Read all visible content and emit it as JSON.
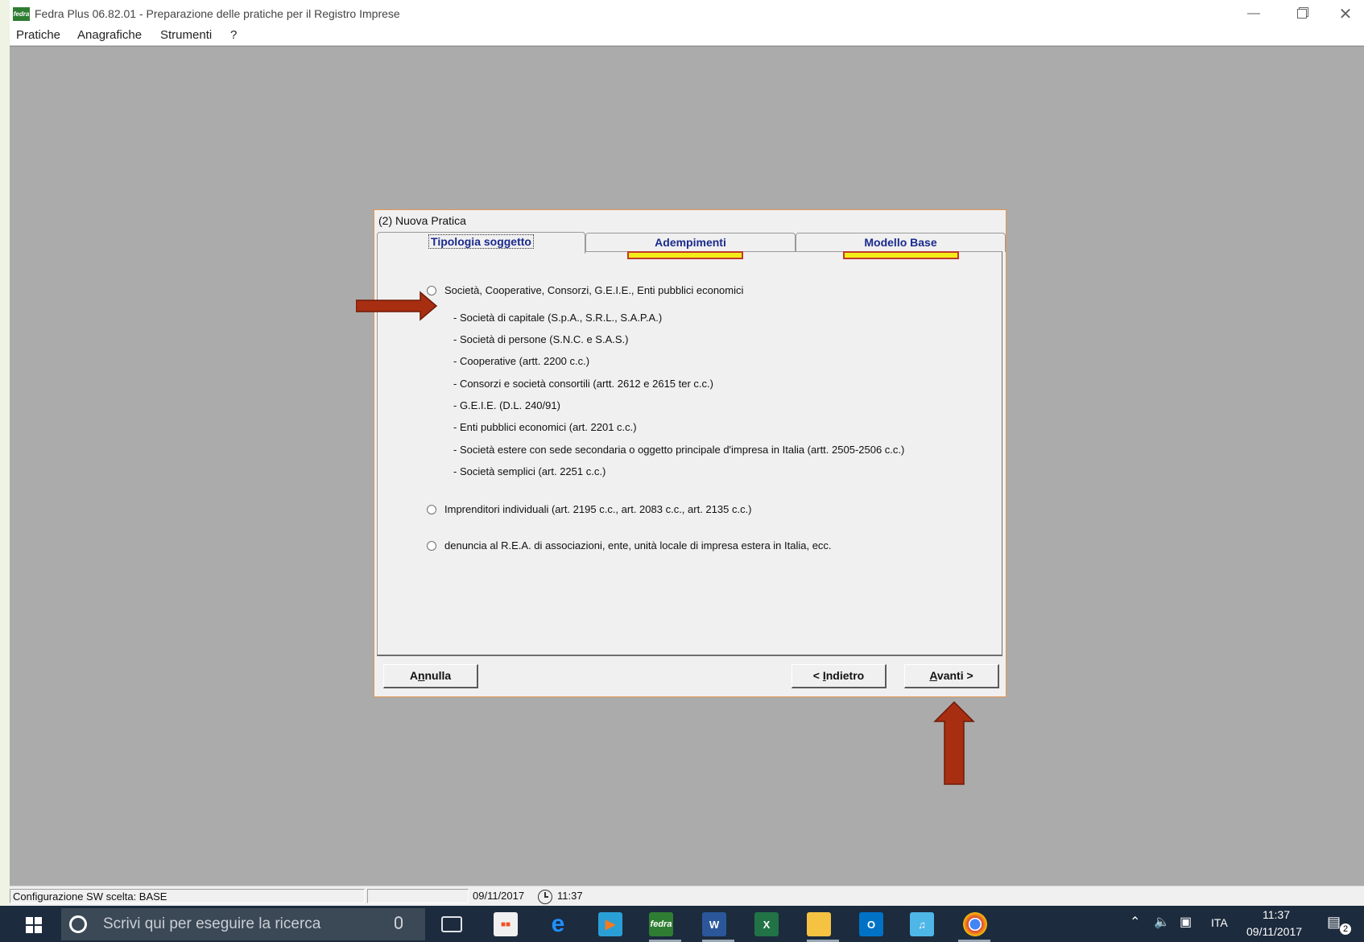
{
  "window": {
    "title": "Fedra Plus 06.82.01 - Preparazione delle pratiche per il Registro Imprese",
    "icon_label": "fedra",
    "minimize_icon": "minimize-icon",
    "restore_icon": "restore-icon",
    "close_icon": "close-icon"
  },
  "menu": {
    "items": [
      "Pratiche",
      "Anagrafiche",
      "Strumenti",
      "?"
    ]
  },
  "dialog": {
    "title": "(2) Nuova Pratica",
    "tabs": [
      {
        "label": "Tipologia soggetto",
        "active": true
      },
      {
        "label": "Adempimenti",
        "active": false
      },
      {
        "label": "Modello Base",
        "active": false
      }
    ],
    "options": [
      {
        "label": "Società, Cooperative, Consorzi, G.E.I.E., Enti pubblici economici",
        "selected": true
      },
      {
        "label": "Imprenditori individuali (art. 2195 c.c., art. 2083 c.c., art. 2135 c.c.)",
        "selected": false
      },
      {
        "label": "denuncia al R.E.A. di associazioni, ente, unità locale di impresa estera in Italia, ecc.",
        "selected": false
      }
    ],
    "sub_items": [
      "- Società di capitale (S.p.A., S.R.L., S.A.P.A.)",
      "- Società di persone (S.N.C. e S.A.S.)",
      "- Cooperative (artt. 2200 c.c.)",
      "- Consorzi e società consortili (artt. 2612 e 2615 ter c.c.)",
      "- G.E.I.E. (D.L. 240/91)",
      "- Enti pubblici economici (art. 2201 c.c.)",
      "- Società estere con sede secondaria o oggetto principale d'impresa in Italia (artt. 2505-2506 c.c.)",
      "- Società semplici (art. 2251 c.c.)"
    ],
    "buttons": {
      "annulla_pre": "A",
      "annulla_key": "n",
      "annulla_post": "nulla",
      "indietro_pre": "< ",
      "indietro_key": "I",
      "indietro_post": "ndietro",
      "avanti_pre": "",
      "avanti_key": "A",
      "avanti_post": "vanti >"
    }
  },
  "statusbar": {
    "config": "Configurazione SW scelta: BASE",
    "empty": "",
    "date": "09/11/2017",
    "time": "11:37"
  },
  "taskbar": {
    "search_placeholder": "Scrivi qui per eseguire la ricerca",
    "apps": [
      "task-view-icon",
      "store-icon",
      "edge-icon",
      "media-player-icon",
      "fedra-icon",
      "word-icon",
      "excel-icon",
      "file-explorer-icon",
      "outlook-icon",
      "music-icon",
      "chrome-icon"
    ],
    "tray_language": "ITA",
    "tray_time": "11:37",
    "tray_date": "09/11/2017",
    "notification_count": "2"
  },
  "colors": {
    "annotation_arrow": "#a82e12",
    "tab_highlight": "#f3ec16",
    "tab_text": "#1a2a8e",
    "workspace": "#ababab",
    "taskbar": "#1c2b3d"
  }
}
